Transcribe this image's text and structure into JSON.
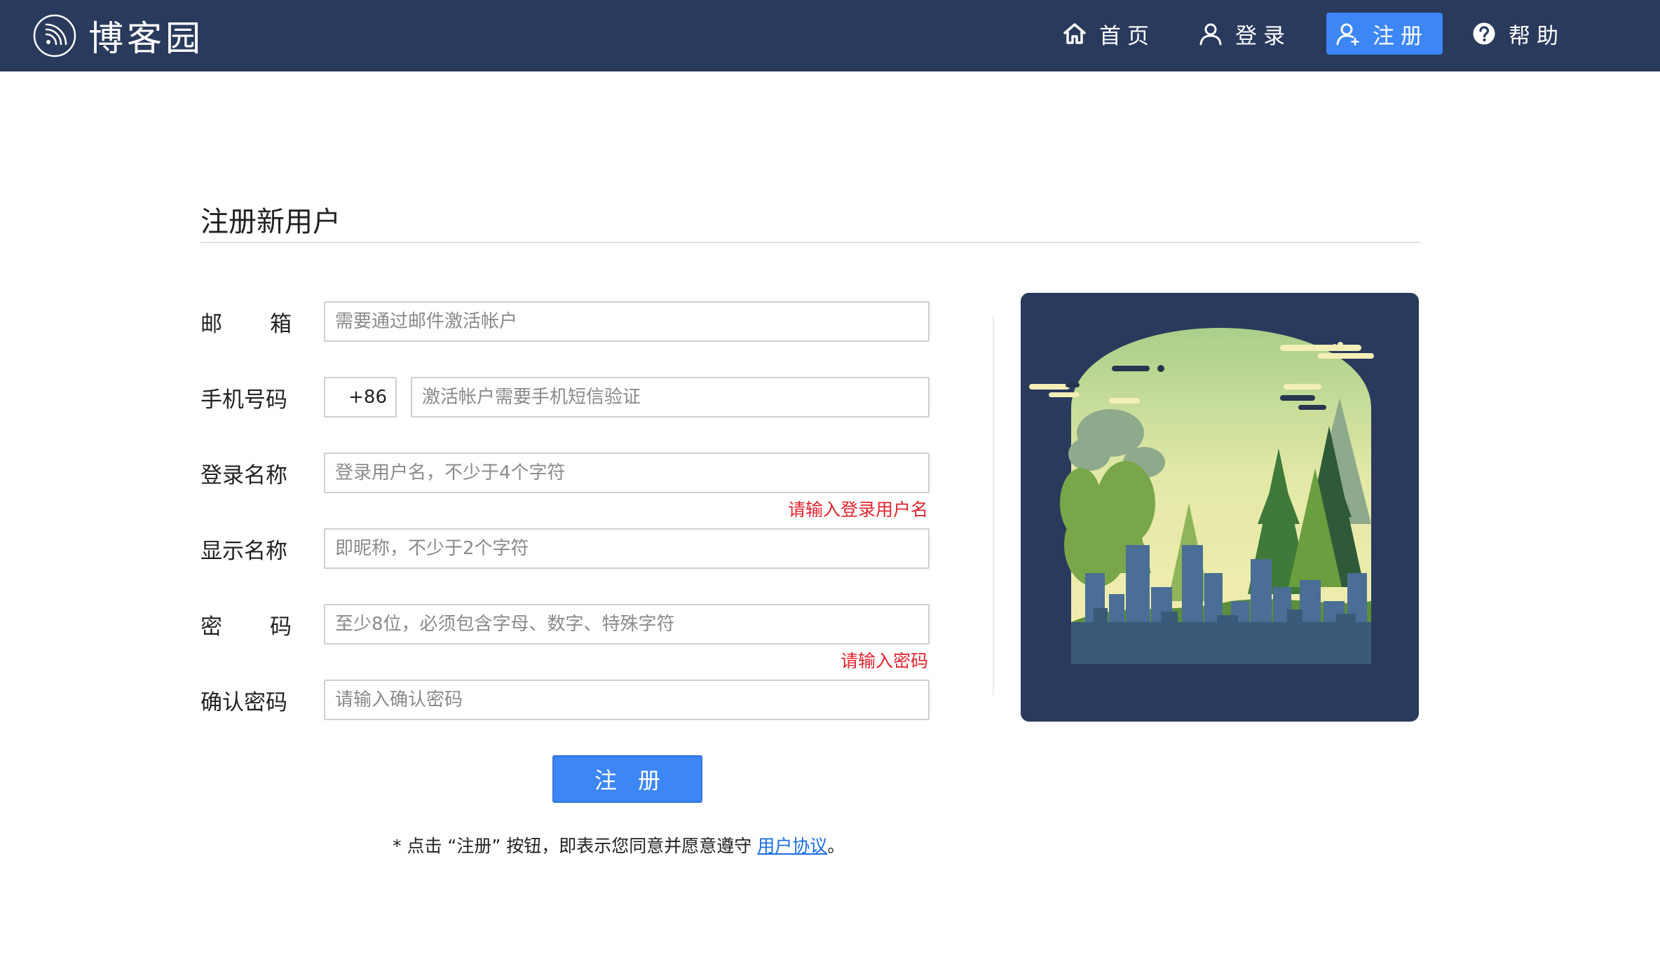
{
  "brand": {
    "name": "博客园"
  },
  "nav": {
    "items": [
      {
        "label": "首页",
        "icon": "home-icon",
        "active": false
      },
      {
        "label": "登录",
        "icon": "user-icon",
        "active": false
      },
      {
        "label": "注册",
        "icon": "user-add-icon",
        "active": true
      },
      {
        "label": "帮助",
        "icon": "help-icon",
        "active": false
      }
    ]
  },
  "form": {
    "title": "注册新用户",
    "email": {
      "label": "邮箱",
      "placeholder": "需要通过邮件激活帐户",
      "value": ""
    },
    "phone": {
      "label": "手机号码",
      "prefix": "+86",
      "placeholder": "激活帐户需要手机短信验证",
      "value": ""
    },
    "login_name": {
      "label": "登录名称",
      "placeholder": "登录用户名，不少于4个字符",
      "value": "",
      "error": "请输入登录用户名"
    },
    "display_name": {
      "label": "显示名称",
      "placeholder": "即昵称，不少于2个字符",
      "value": ""
    },
    "password": {
      "label": "密码",
      "placeholder": "至少8位，必须包含字母、数字、特殊字符",
      "value": "",
      "error": "请输入密码"
    },
    "confirm_password": {
      "label": "确认密码",
      "placeholder": "请输入确认密码",
      "value": ""
    },
    "submit_label": "注册",
    "agreement": {
      "prefix": "* 点击 “注册” 按钮，即表示您同意并愿意遵守 ",
      "link": "用户协议",
      "suffix": "。"
    }
  },
  "colors": {
    "header_bg": "#2a3a5c",
    "accent": "#3d86f5",
    "error": "#e0242f",
    "link": "#1a6fe0"
  }
}
